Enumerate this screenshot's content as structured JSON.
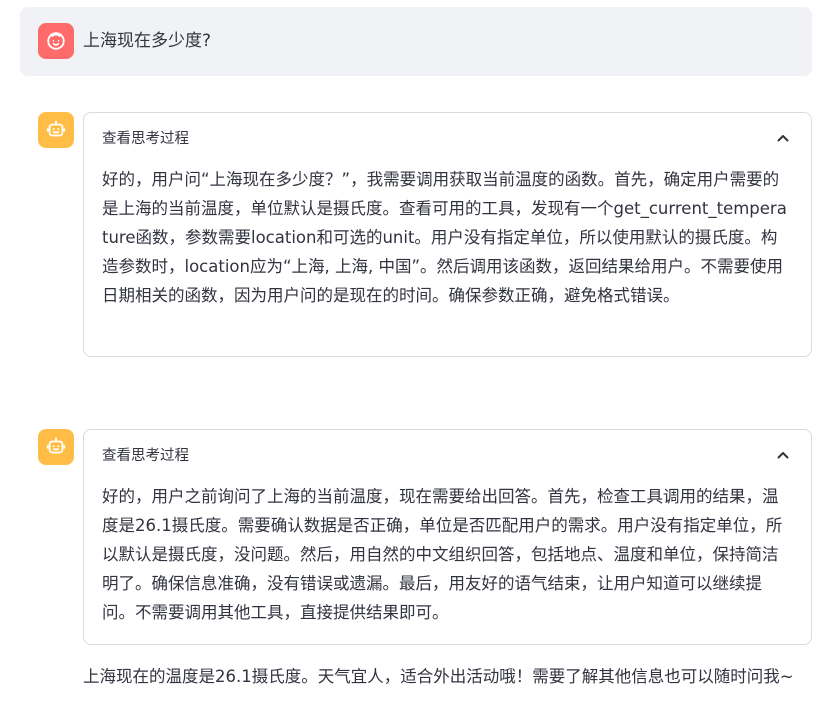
{
  "user_message": {
    "text": "上海现在多少度?"
  },
  "thinking_blocks": [
    {
      "header": "查看思考过程",
      "text": "好的，用户问“上海现在多少度？”，我需要调用获取当前温度的函数。首先，确定用户需要的是上海的当前温度，单位默认是摄氏度。查看可用的工具，发现有一个get_current_temperature函数，参数需要location和可选的unit。用户没有指定单位，所以使用默认的摄氏度。构造参数时，location应为“上海, 上海, 中国”。然后调用该函数，返回结果给用户。不需要使用日期相关的函数，因为用户问的是现在的时间。确保参数正确，避免格式错误。"
    },
    {
      "header": "查看思考过程",
      "text": "好的，用户之前询问了上海的当前温度，现在需要给出回答。首先，检查工具调用的结果，温度是26.1摄氏度。需要确认数据是否正确，单位是否匹配用户的需求。用户没有指定单位，所以默认是摄氏度，没问题。然后，用自然的中文组织回答，包括地点、温度和单位，保持简洁明了。确保信息准确，没有错误或遗漏。最后，用友好的语气结束，让用户知道可以继续提问。不需要调用其他工具，直接提供结果即可。"
    }
  ],
  "assistant_answer": {
    "text": "上海现在的温度是26.1摄氏度。天气宜人，适合外出活动哦！需要了解其他信息也可以随时问我~"
  },
  "colors": {
    "user_avatar": "#ff6b6b",
    "bot_avatar": "#ffbd45",
    "user_bubble": "#f0f2f6",
    "border": "#d9dbe2"
  }
}
